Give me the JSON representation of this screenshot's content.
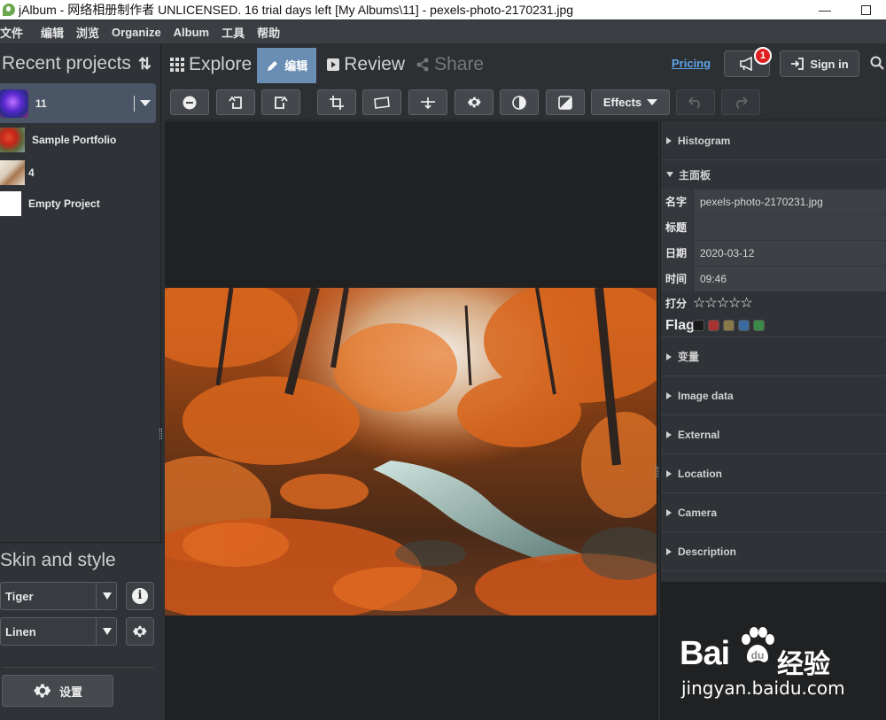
{
  "window": {
    "title": "jAlbum - 网络相册制作者 UNLICENSED. 16 trial days left [My Albums\\11] - pexels-photo-2170231.jpg",
    "minimize_glyph": "—",
    "maximize_icon": "maximize-icon"
  },
  "menu": [
    "文件",
    "编辑",
    "浏览",
    "Organize",
    "Album",
    "工具",
    "帮助"
  ],
  "sidebar": {
    "recent_title": "Recent projects",
    "sort_glyph": "⇅",
    "projects": [
      {
        "label": "11",
        "active": true
      },
      {
        "label": "Sample Portfolio",
        "active": false
      },
      {
        "label": "4",
        "active": false
      },
      {
        "label": "Empty Project",
        "active": false
      }
    ],
    "skin_title": "Skin and style",
    "skin_value": "Tiger",
    "style_value": "Linen",
    "info_glyph": "i",
    "settings_label": "设置"
  },
  "nav": {
    "explore": "Explore",
    "edit": "编辑",
    "review": "Review",
    "share": "Share",
    "pricing": "Pricing",
    "notification_count": "1",
    "sign_in": "Sign in"
  },
  "toolbar": {
    "effects_label": "Effects",
    "tools": [
      "minus-icon",
      "rotate-left-icon",
      "rotate-right-icon",
      "crop-icon",
      "straighten-icon",
      "fix-icon",
      "settings-icon",
      "contrast-icon",
      "image-adjust-icon",
      "undo-icon",
      "redo-icon"
    ]
  },
  "right_panel": {
    "histogram": "Histogram",
    "main_panel": "主面板",
    "fields": {
      "name_label": "名字",
      "name_value": "pexels-photo-2170231.jpg",
      "title_label": "标题",
      "title_value": "",
      "date_label": "日期",
      "date_value": "2020-03-12",
      "time_label": "时间",
      "time_value": "09:46",
      "rating_label": "打分",
      "rating_stars": "☆☆☆☆☆",
      "flag_label": "Flag"
    },
    "flag_colors": [
      "#1a1a1a",
      "#a83232",
      "#8a7a4a",
      "#3a6aa0",
      "#3c8a4a"
    ],
    "collapsed_sections": [
      "变量",
      "Image data",
      "External",
      "Location",
      "Camera",
      "Description"
    ]
  },
  "watermark": {
    "brand_left": "Bai",
    "brand_right": "经验",
    "url": "jingyan.baidu.com"
  }
}
